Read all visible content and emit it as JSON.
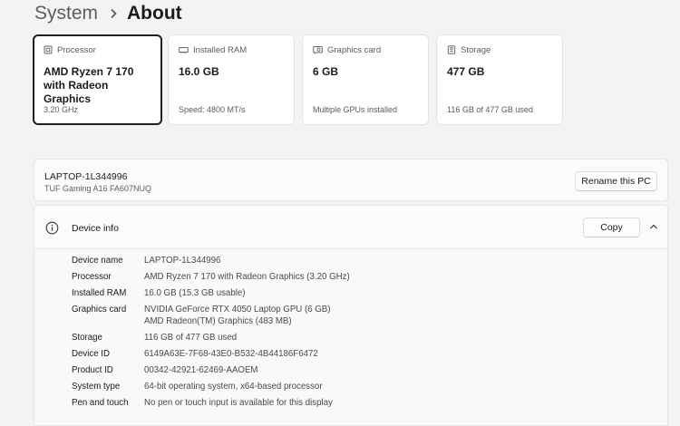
{
  "breadcrumb": {
    "parent": "System",
    "separator": "chevron-right",
    "current": "About"
  },
  "specs": [
    {
      "label": "Processor",
      "icon": "processor-icon",
      "value": "AMD Ryzen 7 170 with Radeon Graphics",
      "sub": "3.20 GHz",
      "selected": true
    },
    {
      "label": "Installed RAM",
      "icon": "ram-icon",
      "value": "16.0 GB",
      "sub": "Speed: 4800 MT/s"
    },
    {
      "label": "Graphics card",
      "icon": "graphics-card-icon",
      "value": "6 GB",
      "sub": "Multiple GPUs installed"
    },
    {
      "label": "Storage",
      "icon": "storage-icon",
      "value": "477 GB",
      "sub": "116 GB of 477 GB used"
    }
  ],
  "pc": {
    "name": "LAPTOP-1L344996",
    "model": "TUF Gaming A16 FA607NUQ",
    "rename_label": "Rename this PC"
  },
  "device_info": {
    "title": "Device info",
    "copy_label": "Copy",
    "rows": [
      {
        "label": "Device name",
        "value": "LAPTOP-1L344996"
      },
      {
        "label": "Processor",
        "value": "AMD Ryzen 7 170 with Radeon Graphics (3.20 GHz)"
      },
      {
        "label": "Installed RAM",
        "value": "16.0 GB (15.3 GB usable)"
      },
      {
        "label": "Graphics card",
        "value": "NVIDIA GeForce RTX 4050 Laptop GPU (6 GB)",
        "value2": "AMD Radeon(TM) Graphics (483 MB)"
      },
      {
        "label": "Storage",
        "value": "116 GB of 477 GB used"
      },
      {
        "label": "Device ID",
        "value": "6149A63E-7F68-43E0-B532-4B44186F6472"
      },
      {
        "label": "Product ID",
        "value": "00342-42921-62469-AAOEM"
      },
      {
        "label": "System type",
        "value": "64-bit operating system, x64-based processor"
      },
      {
        "label": "Pen and touch",
        "value": "No pen or touch input is available for this display"
      }
    ]
  }
}
